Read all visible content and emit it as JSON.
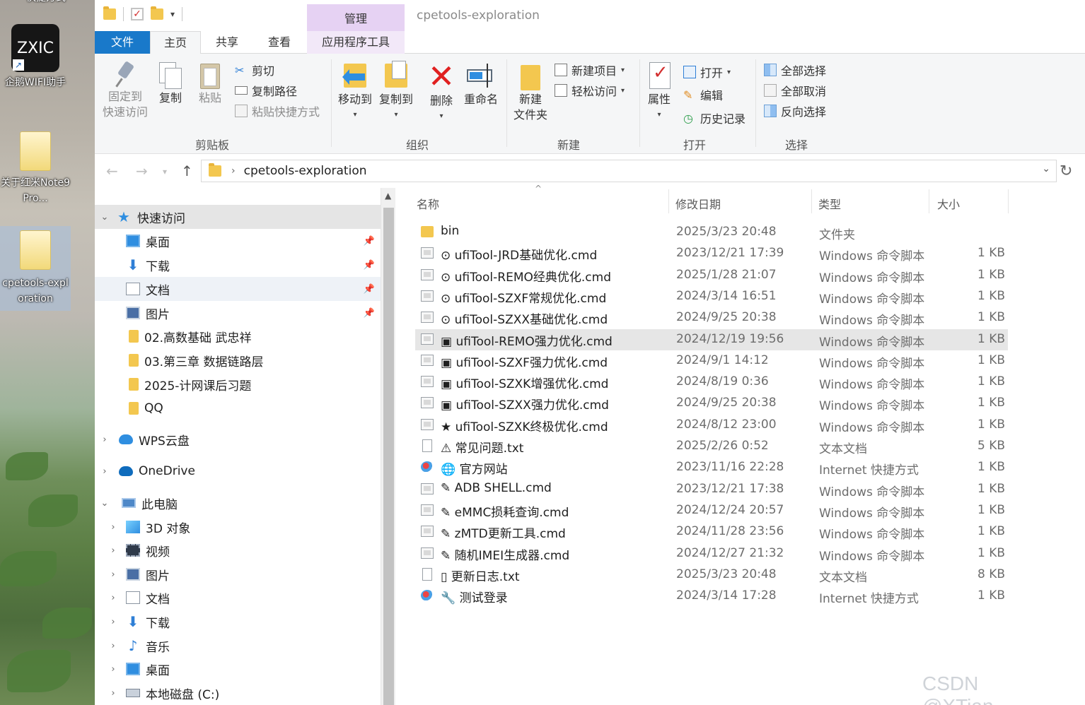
{
  "desktop": {
    "icons": [
      {
        "label": "企鹅WIFI助手",
        "tile_text": "ZXIC"
      },
      {
        "label": "关于红米Note9Pro..."
      },
      {
        "label": "cpetools-exploration"
      }
    ],
    "top_cut_label": "快捷方式"
  },
  "window": {
    "title": "cpetools-exploration",
    "context_tab_header": "管理"
  },
  "tabs": [
    {
      "label": "文件"
    },
    {
      "label": "主页"
    },
    {
      "label": "共享"
    },
    {
      "label": "查看"
    },
    {
      "label": "应用程序工具"
    }
  ],
  "ribbon": {
    "clipboard": {
      "group_label": "剪贴板",
      "pin_line1": "固定到",
      "pin_line2": "快速访问",
      "copy": "复制",
      "paste": "粘贴",
      "cut": "剪切",
      "copy_path": "复制路径",
      "paste_shortcut": "粘贴快捷方式"
    },
    "organize": {
      "group_label": "组织",
      "move_to": "移动到",
      "copy_to": "复制到",
      "delete": "删除",
      "rename": "重命名"
    },
    "new": {
      "group_label": "新建",
      "new_folder_line1": "新建",
      "new_folder_line2": "文件夹",
      "new_item": "新建项目",
      "easy_access": "轻松访问"
    },
    "open": {
      "group_label": "打开",
      "properties": "属性",
      "open": "打开",
      "edit": "编辑",
      "history": "历史记录"
    },
    "select": {
      "group_label": "选择",
      "select_all": "全部选择",
      "select_none": "全部取消",
      "invert": "反向选择"
    }
  },
  "address": {
    "path": "cpetools-exploration"
  },
  "nav": {
    "quick_access": "快速访问",
    "items": [
      {
        "label": "桌面"
      },
      {
        "label": "下载"
      },
      {
        "label": "文档"
      },
      {
        "label": "图片"
      },
      {
        "label": "02.高数基础 武忠祥"
      },
      {
        "label": "03.第三章 数据链路层"
      },
      {
        "label": "2025-计网课后习题"
      },
      {
        "label": "QQ"
      }
    ],
    "wps": "WPS云盘",
    "onedrive": "OneDrive",
    "this_pc": "此电脑",
    "pc_items": [
      {
        "label": "3D 对象"
      },
      {
        "label": "视频"
      },
      {
        "label": "图片"
      },
      {
        "label": "文档"
      },
      {
        "label": "下载"
      },
      {
        "label": "音乐"
      },
      {
        "label": "桌面"
      },
      {
        "label": "本地磁盘 (C:)"
      }
    ]
  },
  "columns": {
    "name": "名称",
    "date": "修改日期",
    "type": "类型",
    "size": "大小"
  },
  "files": [
    {
      "name": "bin",
      "date": "2025/3/23 20:48",
      "type": "文件夹",
      "size": "",
      "icon": "folder"
    },
    {
      "name": "⊙ ufiTool-JRD基础优化.cmd",
      "date": "2023/12/21 17:39",
      "type": "Windows 命令脚本",
      "size": "1 KB",
      "icon": "cmd"
    },
    {
      "name": "⊙ ufiTool-REMO经典优化.cmd",
      "date": "2025/1/28 21:07",
      "type": "Windows 命令脚本",
      "size": "1 KB",
      "icon": "cmd"
    },
    {
      "name": "⊙ ufiTool-SZXF常规优化.cmd",
      "date": "2024/3/14 16:51",
      "type": "Windows 命令脚本",
      "size": "1 KB",
      "icon": "cmd"
    },
    {
      "name": "⊙ ufiTool-SZXX基础优化.cmd",
      "date": "2024/9/25 20:38",
      "type": "Windows 命令脚本",
      "size": "1 KB",
      "icon": "cmd"
    },
    {
      "name": "▣ ufiTool-REMO强力优化.cmd",
      "date": "2024/12/19 19:56",
      "type": "Windows 命令脚本",
      "size": "1 KB",
      "icon": "cmd"
    },
    {
      "name": "▣ ufiTool-SZXF强力优化.cmd",
      "date": "2024/9/1 14:12",
      "type": "Windows 命令脚本",
      "size": "1 KB",
      "icon": "cmd"
    },
    {
      "name": "▣ ufiTool-SZXK增强优化.cmd",
      "date": "2024/8/19 0:36",
      "type": "Windows 命令脚本",
      "size": "1 KB",
      "icon": "cmd"
    },
    {
      "name": "▣ ufiTool-SZXX强力优化.cmd",
      "date": "2024/9/25 20:38",
      "type": "Windows 命令脚本",
      "size": "1 KB",
      "icon": "cmd"
    },
    {
      "name": "★ ufiTool-SZXK终极优化.cmd",
      "date": "2024/8/12 23:00",
      "type": "Windows 命令脚本",
      "size": "1 KB",
      "icon": "cmd"
    },
    {
      "name": "⚠ 常见问题.txt",
      "date": "2025/2/26 0:52",
      "type": "文本文档",
      "size": "5 KB",
      "icon": "txt"
    },
    {
      "name": "🌐 官方网站",
      "date": "2023/11/16 22:28",
      "type": "Internet 快捷方式",
      "size": "1 KB",
      "icon": "url"
    },
    {
      "name": "✎ ADB SHELL.cmd",
      "date": "2023/12/21 17:38",
      "type": "Windows 命令脚本",
      "size": "1 KB",
      "icon": "cmd"
    },
    {
      "name": "✎ eMMC损耗查询.cmd",
      "date": "2024/12/24 20:57",
      "type": "Windows 命令脚本",
      "size": "1 KB",
      "icon": "cmd"
    },
    {
      "name": "✎ zMTD更新工具.cmd",
      "date": "2024/11/28 23:56",
      "type": "Windows 命令脚本",
      "size": "1 KB",
      "icon": "cmd"
    },
    {
      "name": "✎ 随机IMEI生成器.cmd",
      "date": "2024/12/27 21:32",
      "type": "Windows 命令脚本",
      "size": "1 KB",
      "icon": "cmd"
    },
    {
      "name": "▯ 更新日志.txt",
      "date": "2025/3/23 20:48",
      "type": "文本文档",
      "size": "8 KB",
      "icon": "txt"
    },
    {
      "name": "🔧 测试登录",
      "date": "2024/3/14 17:28",
      "type": "Internet 快捷方式",
      "size": "1 KB",
      "icon": "url"
    }
  ],
  "selected_file_index": 5,
  "watermark": "CSDN @XTian___",
  "colors": {
    "file_tab": "#1979ca",
    "context_tab": "#e6d2f3",
    "delete_red": "#e02020",
    "folder_yellow": "#f3c74f"
  }
}
